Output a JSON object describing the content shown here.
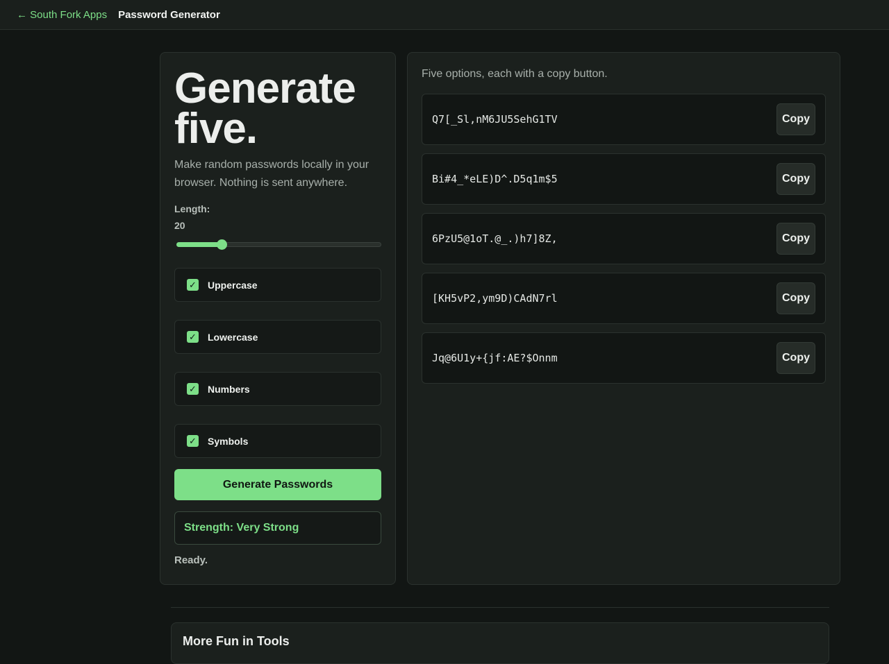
{
  "nav": {
    "back_label": "← South Fork Apps",
    "title": "Password Generator"
  },
  "left": {
    "headline_line1": "Generate",
    "headline_line2": "five.",
    "subtitle": "Make random passwords locally in your browser. Nothing is sent anywhere.",
    "length_label": "Length:",
    "length_value": "20",
    "slider_fraction": 0.22,
    "options": [
      {
        "label": "Uppercase",
        "checked": true
      },
      {
        "label": "Lowercase",
        "checked": true
      },
      {
        "label": "Numbers",
        "checked": true
      },
      {
        "label": "Symbols",
        "checked": true
      }
    ],
    "generate_label": "Generate Passwords",
    "strength": "Strength: Very Strong",
    "status": "Ready."
  },
  "right": {
    "intro": "Five options, each with a copy button.",
    "copy_label": "Copy",
    "passwords": [
      "Q7[_Sl,nM6JU5SehG1TV",
      "Bi#4_*eLE)D^.D5q1m$5",
      "6PzU5@1oT.@_.)h7]8Z,",
      "[KH5vP2,ym9D)CAdN7rl",
      "Jq@6U1y+{jf:AE?$Onnm"
    ]
  },
  "bottom": {
    "title": "More Fun in Tools"
  },
  "colors": {
    "accent": "#7ddf88",
    "background": "#121614",
    "panel": "#1b201d"
  }
}
